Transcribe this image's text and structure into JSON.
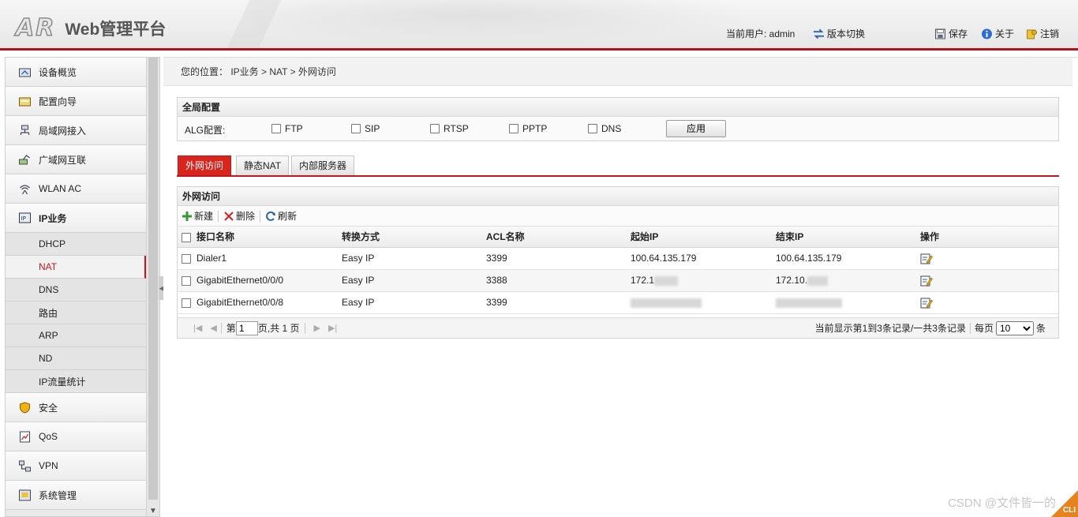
{
  "header": {
    "logo": "AR",
    "title": "Web管理平台",
    "current_user": "当前用户: admin",
    "version_switch": "版本切换",
    "save": "保存",
    "about": "关于",
    "logout": "注销"
  },
  "sidebar": {
    "items": [
      {
        "label": "设备概览",
        "icon": "device-overview-icon"
      },
      {
        "label": "配置向导",
        "icon": "config-wizard-icon"
      },
      {
        "label": "局域网接入",
        "icon": "lan-icon"
      },
      {
        "label": "广域网互联",
        "icon": "wan-icon"
      },
      {
        "label": "WLAN AC",
        "icon": "wlan-icon"
      },
      {
        "label": "IP业务",
        "icon": "ip-service-icon"
      }
    ],
    "subitems": [
      "DHCP",
      "NAT",
      "DNS",
      "路由",
      "ARP",
      "ND",
      "IP流量统计"
    ],
    "items_after": [
      {
        "label": "安全",
        "icon": "shield-icon"
      },
      {
        "label": "QoS",
        "icon": "qos-icon"
      },
      {
        "label": "VPN",
        "icon": "vpn-icon"
      },
      {
        "label": "系统管理",
        "icon": "system-icon"
      }
    ]
  },
  "breadcrumb": "您的位置： IP业务 > NAT > 外网访问",
  "global_config": {
    "title": "全局配置",
    "alg_label": "ALG配置:",
    "options": [
      "FTP",
      "SIP",
      "RTSP",
      "PPTP",
      "DNS"
    ],
    "apply": "应用"
  },
  "tabs": [
    "外网访问",
    "静态NAT",
    "内部服务器"
  ],
  "list": {
    "title": "外网访问",
    "toolbar": {
      "new": "新建",
      "delete": "删除",
      "refresh": "刷新"
    },
    "columns": [
      "接口名称",
      "转换方式",
      "ACL名称",
      "起始IP",
      "结束IP",
      "操作"
    ],
    "rows": [
      {
        "iface": "Dialer1",
        "mode": "Easy IP",
        "acl": "3399",
        "start": "100.64.135.179",
        "end": "100.64.135.179"
      },
      {
        "iface": "GigabitEthernet0/0/0",
        "mode": "Easy IP",
        "acl": "3388",
        "start": "172.1",
        "end": "172.10."
      },
      {
        "iface": "GigabitEthernet0/0/8",
        "mode": "Easy IP",
        "acl": "3399",
        "start": "",
        "end": ""
      }
    ]
  },
  "pager": {
    "page_prefix": "第",
    "page_value": "1",
    "page_suffix": "页,共 1 页",
    "summary": "当前显示第1到3条记录/一共3条记录",
    "per_page_label": "每页",
    "per_page_value": "10",
    "per_page_suffix": "条"
  },
  "watermark": "CSDN @文件皆一的",
  "cli_badge": "CLI",
  "colors": {
    "accent": "#c8141c",
    "tab_active": "#d8261e",
    "cli": "#e6831e"
  }
}
